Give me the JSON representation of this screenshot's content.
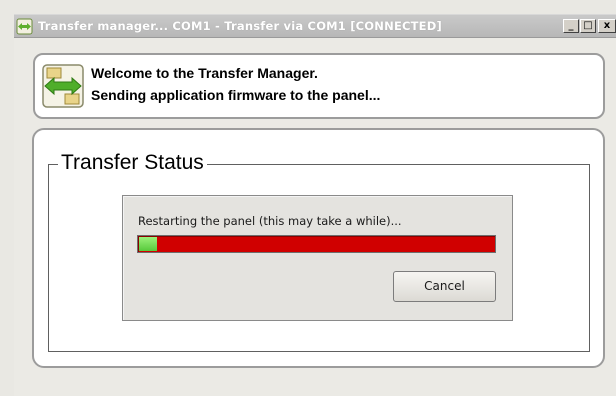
{
  "window": {
    "title": "Transfer manager... COM1 - Transfer via COM1 [CONNECTED]",
    "controls": {
      "minimize": "_",
      "maximize": "□",
      "close": "x"
    }
  },
  "welcome": {
    "line1": "Welcome to the Transfer Manager.",
    "line2": "Sending application firmware to the panel...",
    "icon": "transfer-manager-icon"
  },
  "status": {
    "group_label": "Transfer Status",
    "message": "Restarting the panel (this may take a while)...",
    "progress_fraction": 0.05,
    "cancel_label": "Cancel"
  },
  "colors": {
    "progress_track": "#d00000",
    "progress_fill": "#6ddc4f"
  }
}
